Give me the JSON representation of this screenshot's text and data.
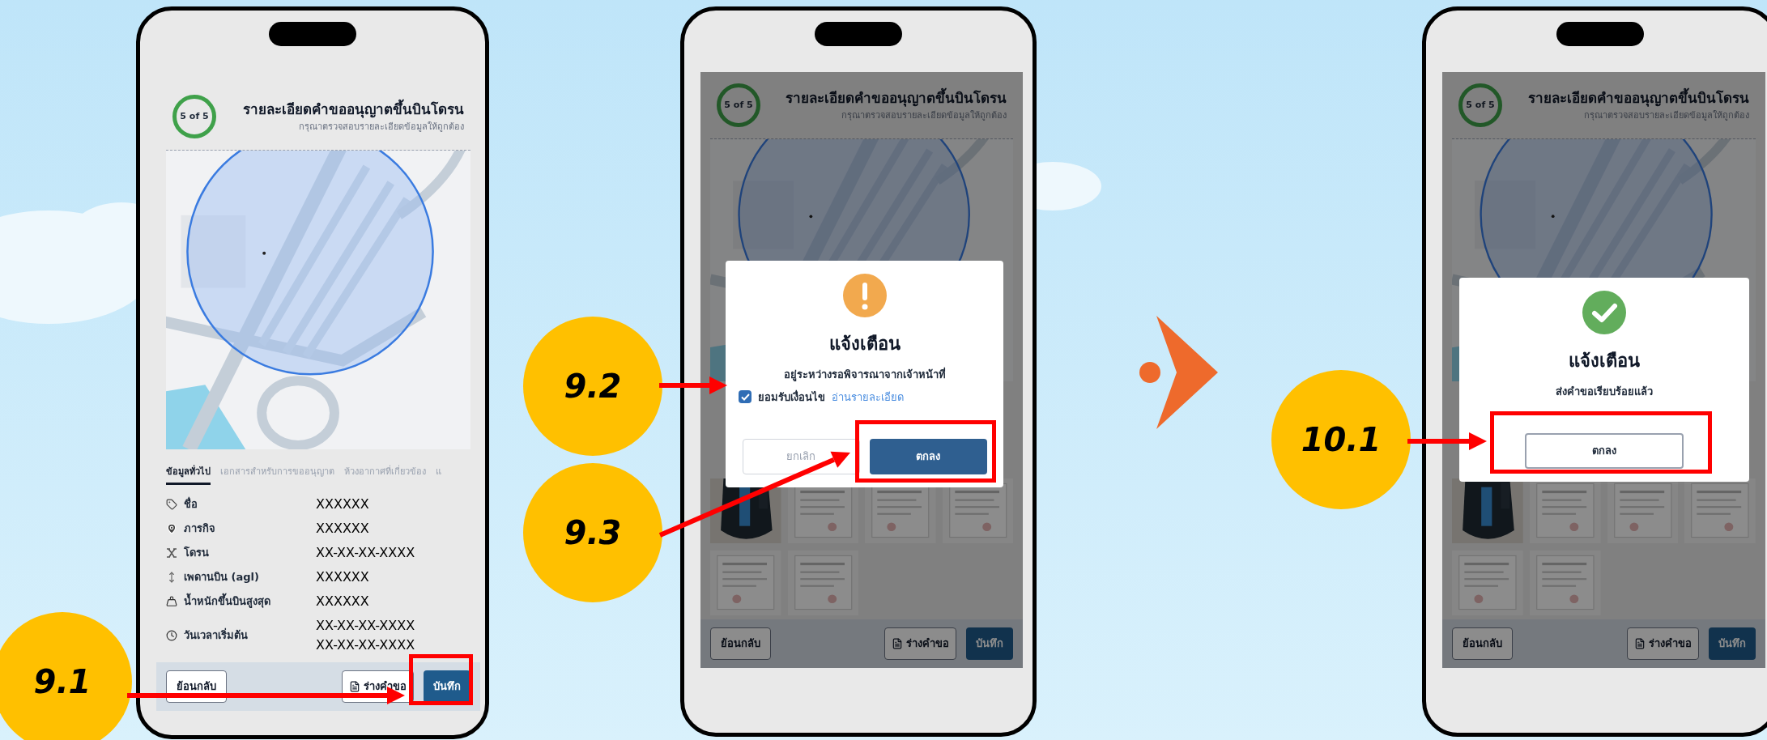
{
  "screens": [
    {
      "header": {
        "step": "5 of 5",
        "title": "รายละเอียดคำขออนุญาตขึ้นบินโดรน",
        "subtitle": "กรุณาตรวจสอบรายละเอียดข้อมูลให้ถูกต้อง"
      },
      "tabs": [
        {
          "label": "ข้อมูลทั่วไป",
          "selected": true
        },
        {
          "label": "เอกสารสำหรับการขออนุญาต",
          "selected": false
        },
        {
          "label": "ห้วงอากาศที่เกี่ยวข้อง",
          "selected": false
        },
        {
          "label": "แ",
          "selected": false
        }
      ],
      "details": [
        {
          "label": "ชื่อ",
          "values": [
            "XXXXXX"
          ]
        },
        {
          "label": "ภารกิจ",
          "values": [
            "XXXXXX"
          ]
        },
        {
          "label": "โดรน",
          "values": [
            "XX-XX-XX-XXXX"
          ]
        },
        {
          "label": "เพดานบิน (agl)",
          "values": [
            "XXXXXX"
          ]
        },
        {
          "label": "น้ำหนักขึ้นบินสูงสุด",
          "values": [
            "XXXXXX"
          ]
        },
        {
          "label": "วันเวลาเริ่มต้น",
          "values": [
            "XX-XX-XX-XXXX",
            "XX-XX-XX-XXXX"
          ]
        }
      ],
      "footer": [
        {
          "label": "ย้อนกลับ",
          "kind": "outline"
        },
        {
          "label": "ร่างคำขอ",
          "kind": "draft"
        },
        {
          "label": "บันทึก",
          "kind": "primary"
        }
      ]
    },
    {
      "header": {
        "step": "5 of 5",
        "title": "รายละเอียดคำขออนุญาตขึ้นบินโดรน",
        "subtitle": "กรุณาตรวจสอบรายละเอียดข้อมูลให้ถูกต้อง"
      },
      "attachments": [
        {
          "kind": "picture"
        },
        {
          "kind": "picture"
        },
        {
          "kind": "picture"
        },
        {
          "kind": "picture"
        },
        {
          "kind": "picture"
        },
        {
          "kind": "picture"
        }
      ],
      "footer": [
        {
          "label": "ย้อนกลับ",
          "kind": "outline"
        },
        {
          "label": "ร่างคำขอ",
          "kind": "draft"
        },
        {
          "label": "บันทึก",
          "kind": "primary"
        }
      ],
      "dialog": {
        "kind": "warning",
        "title": "แจ้งเตือน",
        "message": "อยู่ระหว่างรอพิจารณาจากเจ้าหน้าที่",
        "consent": {
          "label": "ยอมรับเงื่อนไข",
          "link": "อ่านรายละเอียด",
          "checked": true
        },
        "buttons": [
          {
            "label": "ยกเลิก",
            "kind": "cancel"
          },
          {
            "label": "ตกลง",
            "kind": "primary"
          }
        ]
      }
    },
    {
      "header": {
        "step": "5 of 5",
        "title": "รายละเอียดคำขออนุญาตขึ้นบินโดรน",
        "subtitle": "กรุณาตรวจสอบรายละเอียดข้อมูลให้ถูกต้อง"
      },
      "attachments": [
        {
          "kind": "picture"
        },
        {
          "kind": "picture"
        },
        {
          "kind": "picture"
        },
        {
          "kind": "picture"
        },
        {
          "kind": "picture"
        },
        {
          "kind": "picture"
        }
      ],
      "footer": [
        {
          "label": "ย้อนกลับ",
          "kind": "outline"
        },
        {
          "label": "ร่างคำขอ",
          "kind": "draft"
        },
        {
          "label": "บันทึก",
          "kind": "primary"
        }
      ],
      "dialog": {
        "kind": "success",
        "title": "แจ้งเตือน",
        "message": "ส่งคำขอเรียบร้อยแล้ว",
        "buttons": [
          {
            "label": "ตกลง",
            "kind": "outline"
          }
        ]
      }
    }
  ],
  "annotations": [
    {
      "label": "9.1"
    },
    {
      "label": "9.2"
    },
    {
      "label": "9.3"
    },
    {
      "label": "10.1"
    }
  ]
}
